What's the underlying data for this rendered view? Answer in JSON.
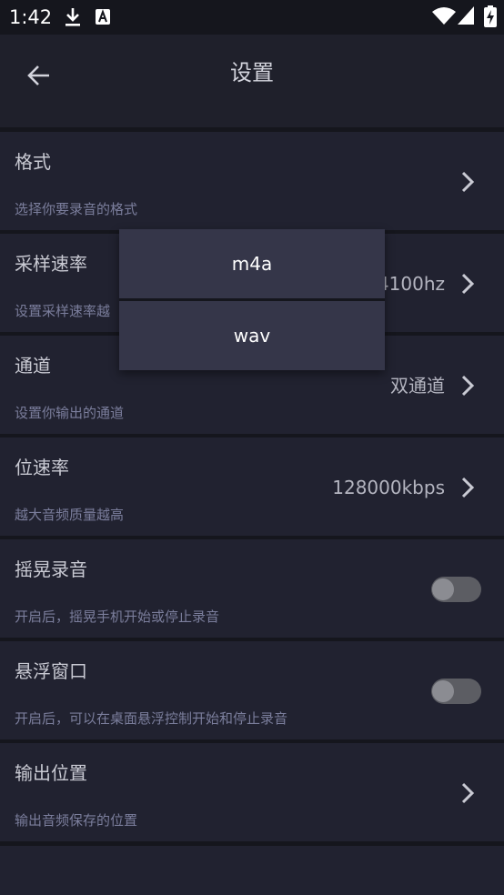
{
  "status_bar": {
    "time": "1:42",
    "icons": [
      "download-icon",
      "text-a-icon",
      "wifi-icon",
      "signal-icon",
      "battery-charging-icon"
    ]
  },
  "app_bar": {
    "title": "设置",
    "back_icon": "arrow-left-icon"
  },
  "settings": [
    {
      "title": "格式",
      "description": "选择你要录音的格式",
      "value": "",
      "control": "chevron"
    },
    {
      "title": "采样速率",
      "description": "设置采样速率越",
      "value": "4100hz",
      "control": "chevron"
    },
    {
      "title": "通道",
      "description": "设置你输出的通道",
      "value": "双通道",
      "control": "chevron"
    },
    {
      "title": "位速率",
      "description": "越大音频质量越高",
      "value": "128000kbps",
      "control": "chevron"
    },
    {
      "title": "摇晃录音",
      "description": "开启后，摇晃手机开始或停止录音",
      "control": "toggle",
      "toggle_on": false
    },
    {
      "title": "悬浮窗口",
      "description": "开启后，可以在桌面悬浮控制开始和停止录音",
      "control": "toggle",
      "toggle_on": false
    },
    {
      "title": "输出位置",
      "description": "输出音频保存的位置",
      "value": "",
      "control": "chevron"
    }
  ],
  "format_popup": {
    "options": [
      "m4a",
      "wav"
    ]
  },
  "colors": {
    "background": "#15161d",
    "row": "#212230",
    "popup": "#353649",
    "title_text": "#c9cad3",
    "description_text": "#7b7e9c"
  }
}
